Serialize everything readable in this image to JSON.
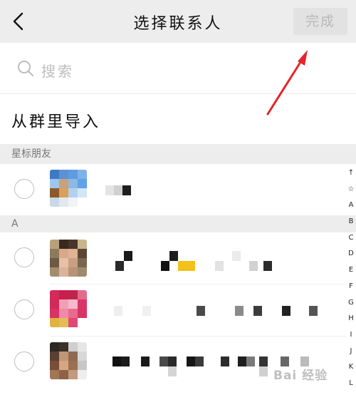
{
  "header": {
    "back_icon": "chevron-left-icon",
    "title": "选择联系人",
    "done_label": "完成"
  },
  "search": {
    "icon": "search-icon",
    "placeholder": "搜索"
  },
  "import_from_group": "从群里导入",
  "sections": [
    {
      "header": "星标朋友"
    },
    {
      "header": "A"
    }
  ],
  "index_bar": [
    "↑",
    "☆",
    "A",
    "B",
    "C",
    "D",
    "E",
    "F",
    "G",
    "H",
    "I",
    "J",
    "K",
    "L"
  ],
  "watermark": "Bai 经验",
  "colors": {
    "nav_bg": "#ededed",
    "section_bg": "#ededed",
    "done_bg": "#e2e2e2",
    "done_text": "#b8b8b8",
    "arrow": "#e4242b"
  }
}
